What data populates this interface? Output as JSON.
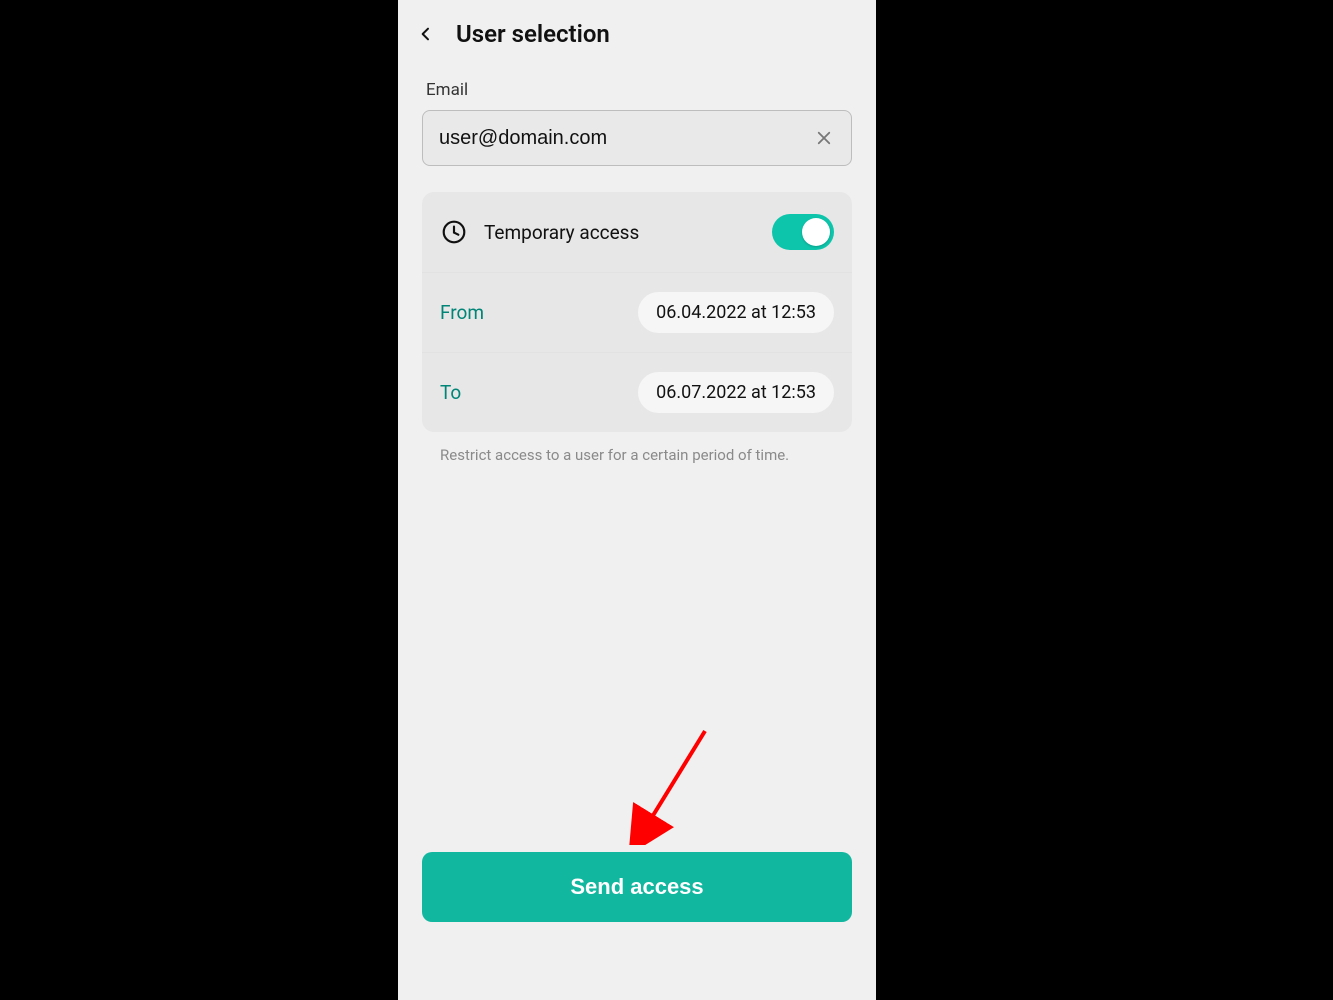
{
  "header": {
    "title": "User selection"
  },
  "email": {
    "label": "Email",
    "value": "user@domain.com"
  },
  "temp_access": {
    "label": "Temporary access",
    "enabled": true,
    "from_label": "From",
    "from_value": "06.04.2022 at 12:53",
    "to_label": "To",
    "to_value": "06.07.2022 at 12:53",
    "hint": "Restrict access to a user for a certain period of time."
  },
  "cta": {
    "label": "Send access"
  },
  "colors": {
    "accent": "#12b7a0"
  }
}
